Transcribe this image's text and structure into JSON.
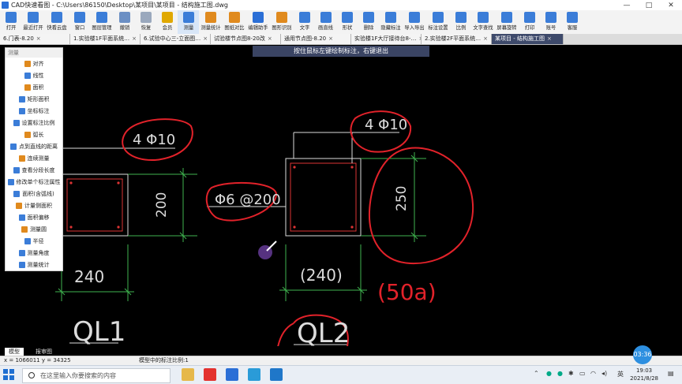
{
  "window": {
    "title": "CAD快速看图 - C:\\Users\\86150\\Desktop\\某项目\\某项目 - 结构施工图.dwg",
    "min": "—",
    "max": "□",
    "close": "✕"
  },
  "toolbar": [
    {
      "label": "打开",
      "icon": "folder-icon",
      "color": "#3b7dd8"
    },
    {
      "label": "最近打开",
      "icon": "recent-icon",
      "color": "#3b7dd8"
    },
    {
      "label": "快看云盘",
      "icon": "cloud-icon",
      "color": "#3b7dd8"
    },
    {
      "label": "窗口",
      "icon": "window-icon",
      "color": "#3b7dd8"
    },
    {
      "label": "图层管理",
      "icon": "layers-icon",
      "color": "#3b7dd8"
    },
    {
      "label": "撤销",
      "icon": "undo-icon",
      "color": "#6b8fc4"
    },
    {
      "label": "恢复",
      "icon": "redo-icon",
      "color": "#9aa8bd"
    },
    {
      "label": "会员",
      "icon": "vip-icon",
      "color": "#e0a800"
    },
    {
      "label": "测量",
      "icon": "measure-icon",
      "color": "#3b7dd8"
    },
    {
      "label": "测量统计",
      "icon": "measure-stats-icon",
      "color": "#e08a1e"
    },
    {
      "label": "图纸对比",
      "icon": "compare-icon",
      "color": "#e08a1e"
    },
    {
      "label": "编辑助手",
      "icon": "edit-assistant-icon",
      "color": "#2b6fd6"
    },
    {
      "label": "图形识别",
      "icon": "recognize-icon",
      "color": "#e08a1e"
    },
    {
      "label": "文字",
      "icon": "text-icon",
      "color": "#3b7dd8"
    },
    {
      "label": "画直线",
      "icon": "line-icon",
      "color": "#3b7dd8"
    },
    {
      "label": "形状",
      "icon": "shape-icon",
      "color": "#3b7dd8"
    },
    {
      "label": "删除",
      "icon": "eraser-icon",
      "color": "#3b7dd8"
    },
    {
      "label": "隐藏标注",
      "icon": "hide-annotation-icon",
      "color": "#3b7dd8"
    },
    {
      "label": "导入导出",
      "icon": "import-export-icon",
      "color": "#3b7dd8"
    },
    {
      "label": "标注设置",
      "icon": "annotation-settings-icon",
      "color": "#3b7dd8"
    },
    {
      "label": "比例",
      "icon": "scale-icon",
      "color": "#3b7dd8"
    },
    {
      "label": "文字查找",
      "icon": "text-search-icon",
      "color": "#3b7dd8"
    },
    {
      "label": "屏幕旋转",
      "icon": "rotate-screen-icon",
      "color": "#3b7dd8"
    },
    {
      "label": "打印",
      "icon": "print-icon",
      "color": "#3b7dd8"
    },
    {
      "label": "账号",
      "icon": "account-icon",
      "color": "#3b7dd8"
    },
    {
      "label": "客服",
      "icon": "headset-icon",
      "color": "#3b7dd8"
    }
  ],
  "tabs": [
    {
      "label": "6.门表-8.20"
    },
    {
      "label": "1.实验楼1F平面系统…"
    },
    {
      "label": "6.试验中心三-立面图…"
    },
    {
      "label": "试验楼节点图8-20改"
    },
    {
      "label": "通用节点图-8.20"
    },
    {
      "label": "实验楼1F大厅接待台8-…"
    },
    {
      "label": "2.实验楼2F平面系统…"
    },
    {
      "label": "某项目 - 结构施工图",
      "active": true
    }
  ],
  "hint": "按住鼠标左键绘制标注，右键退出",
  "measure_panel": {
    "header": "测量",
    "items": [
      "对齐",
      "线性",
      "面积",
      "矩形面积",
      "坐标标注",
      "设置标注比例",
      "弧长",
      "点到直线的距离",
      "连续测量",
      "查看分段长度",
      "修改单个标注属性",
      "面积(含弧线)",
      "计量侧面积",
      "面积偏移",
      "测量圆",
      "半径",
      "测量角度",
      "测量统计"
    ]
  },
  "drawing": {
    "left_rebar": "4 Φ10",
    "left_height": "200",
    "left_width": "240",
    "stirrup": "Φ6 @200",
    "right_rebar": "4 Φ10",
    "right_height": "250",
    "right_width": "(240)",
    "handwritten_note": "(50a)",
    "label_left": "QL1",
    "label_right": "QL2"
  },
  "model_tabs": [
    "模型",
    "报审图"
  ],
  "status": {
    "coords": "x = 1066011  y = 34325",
    "scale_text": "模型中的标注比例:1"
  },
  "timer": "03:36",
  "taskbar": {
    "search_placeholder": "在这里输入你要搜索的内容",
    "ime": "英",
    "time": "19:03",
    "date": "2021/8/28"
  }
}
